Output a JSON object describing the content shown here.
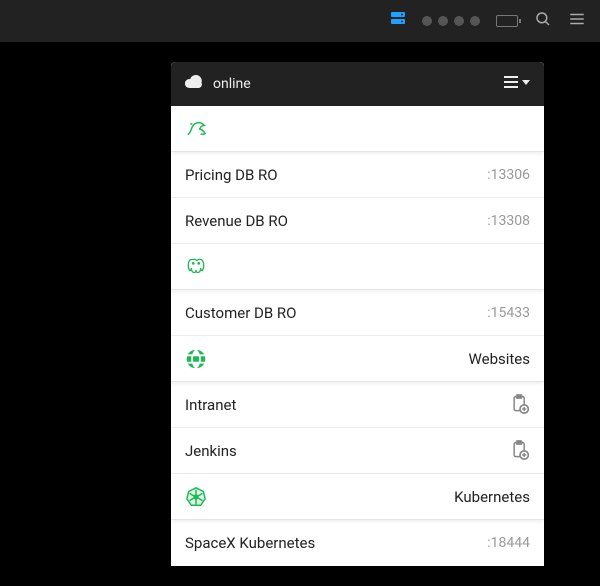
{
  "topbar": {
    "server_color": "#1ea1ff",
    "dot_color": "#555"
  },
  "panel": {
    "status_label": "online",
    "sections": [
      {
        "icon": "mysql",
        "label": ""
      },
      {
        "icon": "postgres",
        "label": ""
      },
      {
        "icon": "globe",
        "label": "Websites"
      },
      {
        "icon": "kubernetes",
        "label": "Kubernetes"
      }
    ],
    "rows": {
      "mysql": [
        {
          "name": "Pricing DB RO",
          "port": ":13306"
        },
        {
          "name": "Revenue DB RO",
          "port": ":13308"
        }
      ],
      "postgres": [
        {
          "name": "Customer DB RO",
          "port": ":15433"
        }
      ],
      "web": [
        {
          "name": "Intranet",
          "action": "clipboard-add"
        },
        {
          "name": "Jenkins",
          "action": "clipboard-add"
        }
      ],
      "k8s": [
        {
          "name": "SpaceX Kubernetes",
          "port": ":18444"
        }
      ]
    }
  }
}
